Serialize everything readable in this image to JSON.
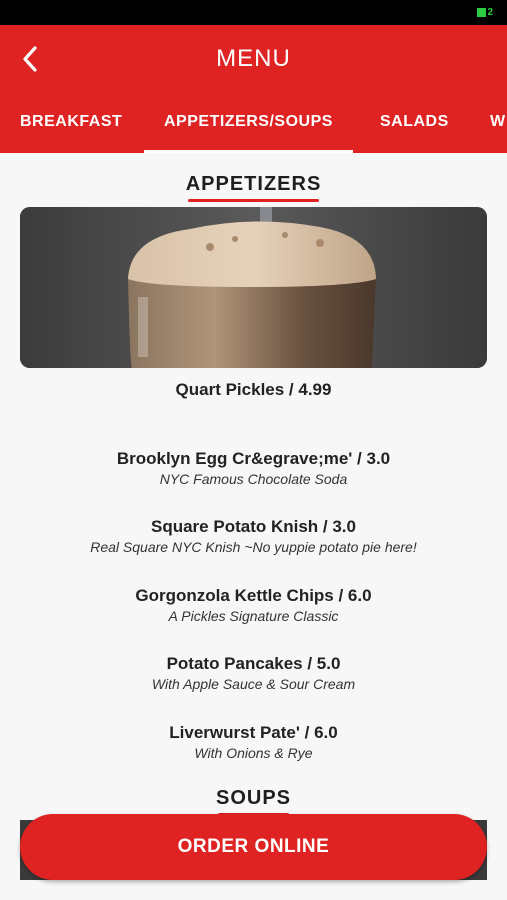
{
  "header": {
    "back_icon": "chevron-left-icon",
    "title": "MENU",
    "accent_color": "#df2222"
  },
  "tabs": [
    {
      "label": "BREAKFAST",
      "active": false
    },
    {
      "label": "APPETIZERS/SOUPS",
      "active": true
    },
    {
      "label": "SALADS",
      "active": false
    },
    {
      "label": "W",
      "active": false
    }
  ],
  "sections": {
    "appetizers_title": "APPETIZERS",
    "soups_title": "SOUPS"
  },
  "menu_items": [
    {
      "name": "Quart Pickles / 4.99",
      "description": ""
    },
    {
      "name": "Brooklyn Egg Cr&egrave;me' / 3.0",
      "description": "NYC Famous Chocolate Soda"
    },
    {
      "name": "Square Potato Knish / 3.0",
      "description": "Real Square NYC Knish ~No yuppie potato pie here!"
    },
    {
      "name": "Gorgonzola Kettle Chips / 6.0",
      "description": "A Pickles Signature Classic"
    },
    {
      "name": "Potato Pancakes / 5.0",
      "description": "With Apple Sauce & Sour Cream"
    },
    {
      "name": "Liverwurst Pate' / 6.0",
      "description": "With Onions & Rye"
    }
  ],
  "footer": {
    "order_label": "ORDER ONLINE"
  }
}
